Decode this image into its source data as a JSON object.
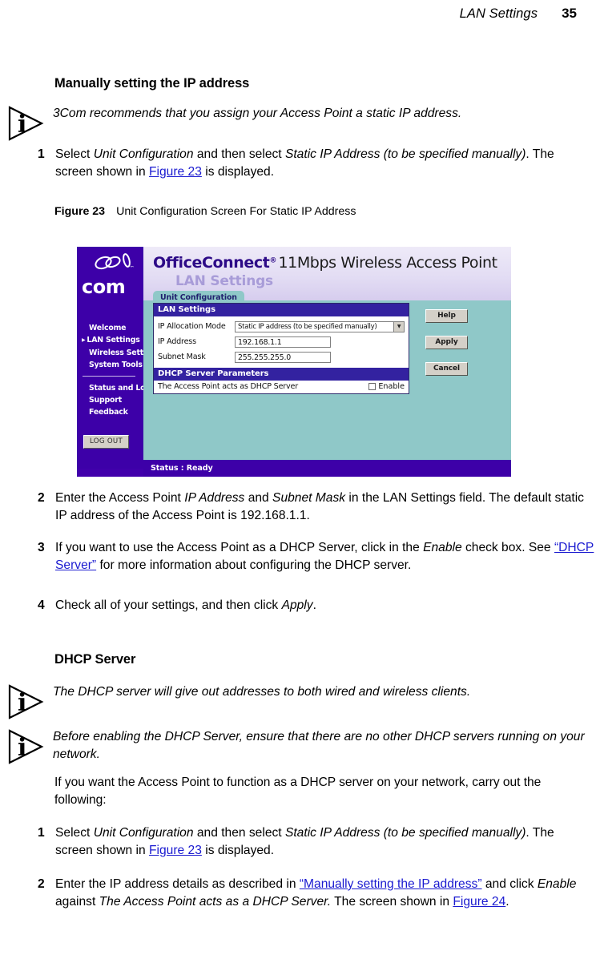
{
  "header": {
    "chapter_title": "LAN Settings",
    "page_number": "35"
  },
  "sections": {
    "manual_ip_heading": "Manually setting the IP address",
    "dhcp_server_heading": "DHCP Server"
  },
  "notes": {
    "note1": "3Com recommends that you assign your Access Point a static IP address.",
    "note2": "The DHCP server will give out addresses to both wired and wireless clients.",
    "note3": "Before enabling the DHCP Server, ensure that there are no other DHCP servers running on your network.",
    "icon": "info-triangle-icon"
  },
  "steps": {
    "s1_num": "1",
    "s1_a": "Select ",
    "s1_b": "Unit Configuration",
    "s1_c": " and then select ",
    "s1_d": "Static IP Address (to be specified manually)",
    "s1_e": ". The screen shown in ",
    "s1_link": "Figure 23",
    "s1_f": " is displayed.",
    "s2_num": "2",
    "s2_a": "Enter the Access Point ",
    "s2_b": "IP Address",
    "s2_c": " and ",
    "s2_d": "Subnet Mask",
    "s2_e": " in the LAN Settings field. The default static IP address of the Access Point is 192.168.1.1.",
    "s3_num": "3",
    "s3_a": "If you want to use the Access Point as a DHCP Server, click in the ",
    "s3_b": "Enable",
    "s3_c": " check box. See ",
    "s3_link": "“DHCP Server”",
    "s3_d": " for more information about configuring the DHCP server.",
    "s4_num": "4",
    "s4_a": "Check all of your settings, and then click ",
    "s4_b": "Apply",
    "s4_c": ".",
    "d_intro": "If you want the Access Point to function as a DHCP server on your network, carry out the following:",
    "d1_num": "1",
    "d1_a": "Select ",
    "d1_b": "Unit Configuration",
    "d1_c": " and then select ",
    "d1_d": "Static IP Address (to be specified manually)",
    "d1_e": ". The screen shown in ",
    "d1_link": "Figure 23",
    "d1_f": " is displayed.",
    "d2_num": "2",
    "d2_a": "Enter the IP address details as described in ",
    "d2_link1": "“Manually setting the IP address”",
    "d2_b": " and click ",
    "d2_c": "Enable",
    "d2_d": " against ",
    "d2_e": "The Access Point acts as a DHCP Server.",
    "d2_f": " The screen shown in ",
    "d2_link2": "Figure 24",
    "d2_g": "."
  },
  "figure": {
    "label": "Figure 23",
    "caption": "Unit Configuration Screen For Static IP Address"
  },
  "screenshot": {
    "logo_word": "com",
    "logo_mark": "3com-rings-logo-icon",
    "nav_items": [
      {
        "label": "Welcome",
        "selected": false
      },
      {
        "label": "LAN Settings",
        "selected": true
      },
      {
        "label": "Wireless Settings",
        "selected": false
      },
      {
        "label": "System Tools",
        "selected": false
      }
    ],
    "nav_items2": [
      {
        "label": "Status and Logs"
      },
      {
        "label": "Support"
      },
      {
        "label": "Feedback"
      }
    ],
    "logout_label": "LOG OUT",
    "brand_name": "OfficeConnect",
    "brand_reg": "®",
    "brand_rest": "11Mbps Wireless Access Point",
    "brand_subtitle": "LAN Settings",
    "tab_label": "Unit Configuration",
    "card1_title": "LAN Settings",
    "fields": [
      {
        "label": "IP Allocation Mode",
        "value": "Static IP address (to be specified manually)",
        "type": "select"
      },
      {
        "label": "IP Address",
        "value": "192.168.1.1",
        "type": "text"
      },
      {
        "label": "Subnet Mask",
        "value": "255.255.255.0",
        "type": "text"
      }
    ],
    "card2_title": "DHCP Server Parameters",
    "dhcp_row_label": "The Access Point acts as DHCP Server",
    "dhcp_checkbox_label": "Enable",
    "buttons": [
      {
        "label": "Help"
      },
      {
        "label": "Apply"
      },
      {
        "label": "Cancel"
      }
    ],
    "status_text": "Status : Ready",
    "colors": {
      "nav_purple": "#3d00a8",
      "pane_teal": "#8fc8c8",
      "card_bar_blue": "#3322a0",
      "brand_purple": "#2d0a87",
      "brand_sub_lavender": "#a89cd8"
    }
  }
}
